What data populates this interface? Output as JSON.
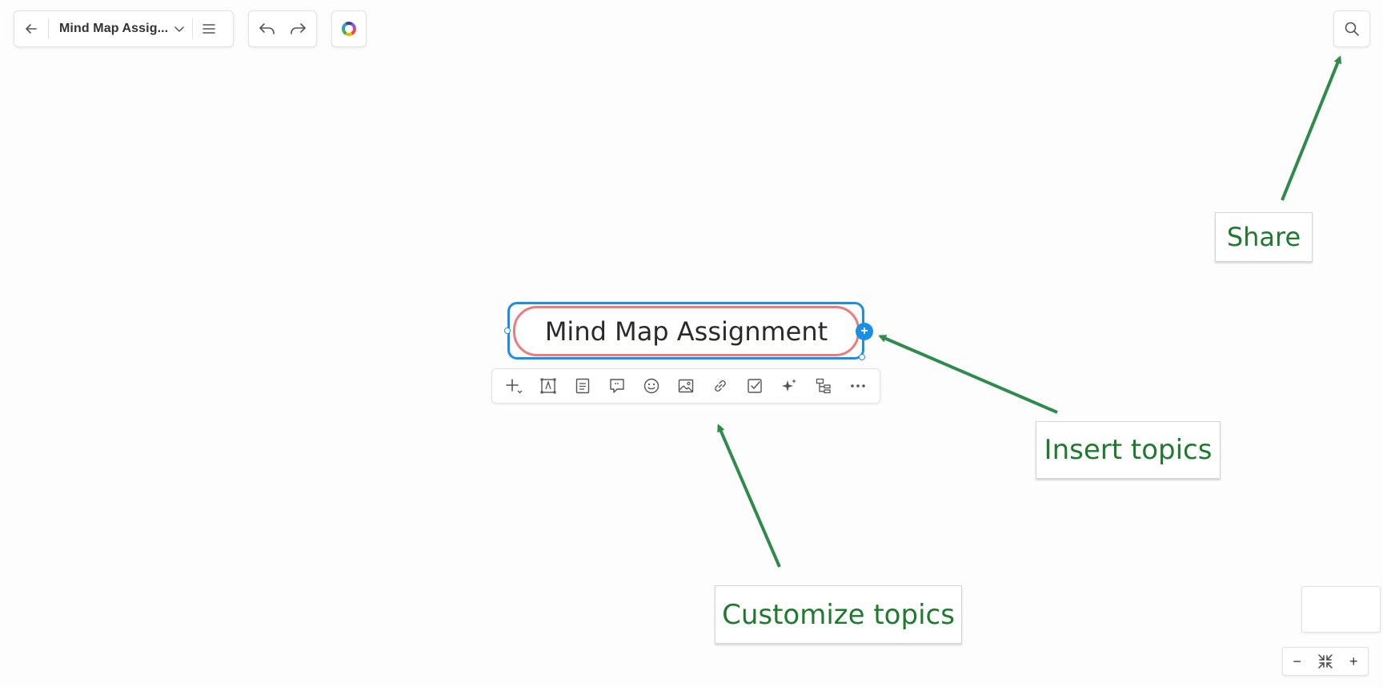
{
  "header": {
    "doc_title": "Mind Map Assig...",
    "back_icon": "arrow-left-icon",
    "title_dropdown_icon": "chevron-down-icon",
    "menu_icon": "hamburger-menu-icon",
    "undo_icon": "undo-icon",
    "redo_icon": "redo-icon",
    "theme_icon": "color-wheel-icon",
    "search_icon": "search-icon"
  },
  "canvas": {
    "central_topic": "Mind Map Assignment",
    "topic_border_color": "#ec7b7b",
    "selection_color": "#1a8fe8",
    "add_topic_label": "+"
  },
  "topic_toolbar": {
    "items": [
      "add-subtopic-icon",
      "topic-style-icon",
      "note-icon",
      "comment-icon",
      "emoji-icon",
      "image-icon",
      "link-icon",
      "task-icon",
      "ai-sparkle-icon",
      "structure-icon",
      "more-icon"
    ]
  },
  "annotations": {
    "share": "Share",
    "insert_topics": "Insert topics",
    "customize_topics": "Customize topics",
    "color": "#1f7a2e",
    "arrow_color": "#2e8b4a"
  },
  "zoom": {
    "zoom_out_label": "−",
    "fit_icon": "fit-to-screen-icon",
    "zoom_in_label": "+"
  }
}
